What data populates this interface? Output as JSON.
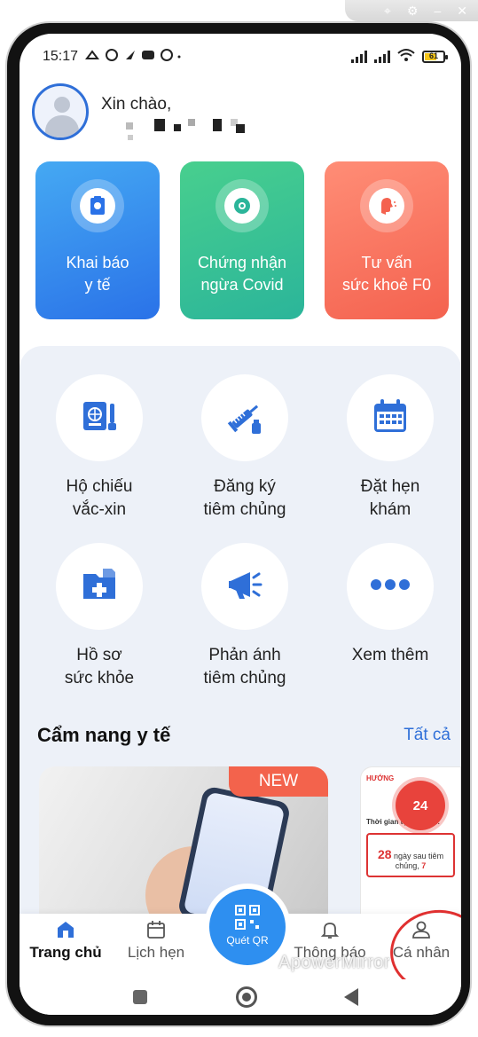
{
  "status_bar": {
    "time": "15:17",
    "battery": "61"
  },
  "header": {
    "greeting": "Xin chào,"
  },
  "quick_cards": [
    {
      "label_1": "Khai báo",
      "label_2": "y tế",
      "color": "#2a72e8"
    },
    {
      "label_1": "Chứng nhận",
      "label_2": "ngừa Covid",
      "color": "#2bb59a"
    },
    {
      "label_1": "Tư vấn",
      "label_2": "sức khoẻ F0",
      "color": "#f4624f"
    }
  ],
  "services": [
    {
      "label_1": "Hộ chiếu",
      "label_2": "vắc-xin",
      "icon": "passport-icon"
    },
    {
      "label_1": "Đăng ký",
      "label_2": "tiêm chủng",
      "icon": "syringe-icon"
    },
    {
      "label_1": "Đặt hẹn",
      "label_2": "khám",
      "icon": "calendar-icon"
    },
    {
      "label_1": "Hồ sơ",
      "label_2": "sức khỏe",
      "icon": "health-folder-icon"
    },
    {
      "label_1": "Phản ánh",
      "label_2": "tiêm chủng",
      "icon": "megaphone-icon"
    },
    {
      "label_1": "Xem thêm",
      "label_2": "",
      "icon": "more-icon"
    }
  ],
  "handbook": {
    "title": "Cẩm nang y tế",
    "see_all": "Tất cả",
    "new_badge": "NEW",
    "card2_lines": [
      "HƯỚNG",
      "Thời gian tự theo dõi:",
      "28",
      "ngày sau tiêm chủng,",
      "7"
    ],
    "hotline": "24"
  },
  "bottom_nav": {
    "home": "Trang chủ",
    "appointments": "Lịch hẹn",
    "scan_qr": "Quét QR",
    "notifications": "Thông báo",
    "profile": "Cá nhân"
  },
  "watermark": "ApowerMirror",
  "colors": {
    "primary": "#2f6fd8",
    "panel_bg": "#edf1f8",
    "accent_red": "#f3634c"
  }
}
